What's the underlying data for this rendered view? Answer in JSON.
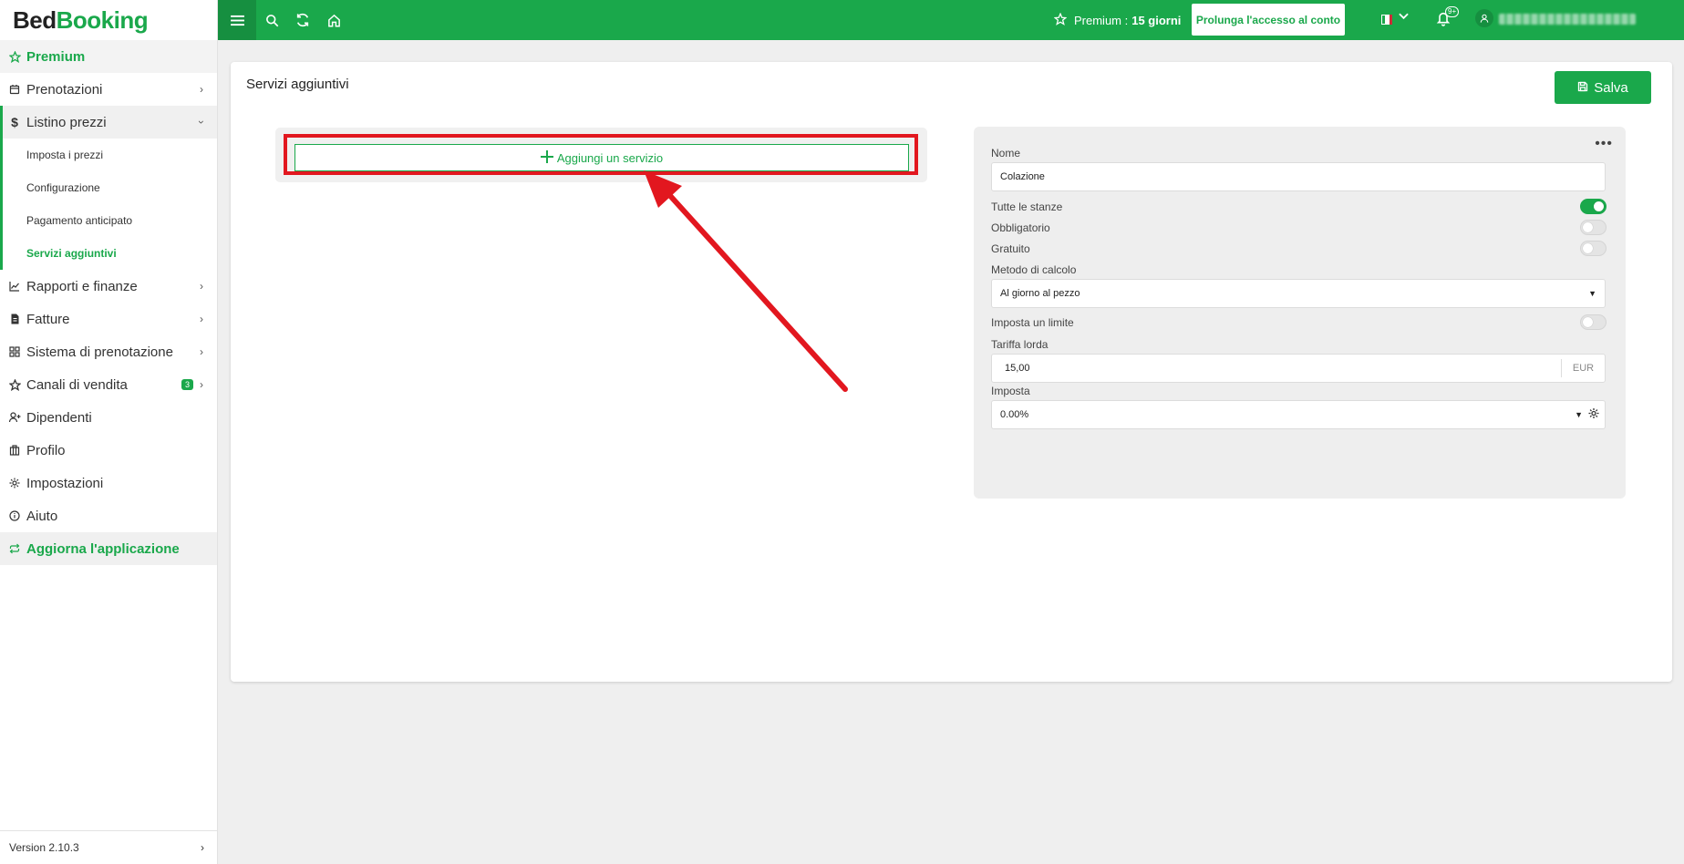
{
  "brand": {
    "part1": "Bed",
    "part2": "Booking"
  },
  "sidebar": {
    "premium": "Premium",
    "items": [
      {
        "label": "Prenotazioni"
      },
      {
        "label": "Listino prezzi"
      },
      {
        "label": "Rapporti e finanze"
      },
      {
        "label": "Fatture"
      },
      {
        "label": "Sistema di prenotazione"
      },
      {
        "label": "Canali di vendita",
        "badge": "3"
      },
      {
        "label": "Dipendenti"
      },
      {
        "label": "Profilo"
      },
      {
        "label": "Impostazioni"
      },
      {
        "label": "Aiuto"
      }
    ],
    "subitems": [
      "Imposta i prezzi",
      "Configurazione",
      "Pagamento anticipato",
      "Servizi aggiuntivi"
    ],
    "update": "Aggiorna l'applicazione",
    "version": "Version 2.10.3"
  },
  "topbar": {
    "premium_label": "Premium :",
    "premium_days": "15 giorni",
    "extend_button": "Prolunga l'accesso al conto",
    "notifications_badge": "9+",
    "accent": "#1aa84b"
  },
  "page": {
    "title": "Servizi aggiuntivi",
    "save_button": "Salva",
    "add_service_button": "Aggiungi un servizio"
  },
  "form": {
    "name_label": "Nome",
    "name_value": "Colazione",
    "all_rooms_label": "Tutte le stanze",
    "all_rooms_on": true,
    "mandatory_label": "Obbligatorio",
    "mandatory_on": false,
    "free_label": "Gratuito",
    "free_on": false,
    "calc_label": "Metodo di calcolo",
    "calc_value": "Al giorno al pezzo",
    "limit_label": "Imposta un limite",
    "limit_on": false,
    "rate_label": "Tariffa lorda",
    "rate_value": "15,00",
    "rate_unit": "EUR",
    "tax_label": "Imposta",
    "tax_value": "0.00%"
  }
}
